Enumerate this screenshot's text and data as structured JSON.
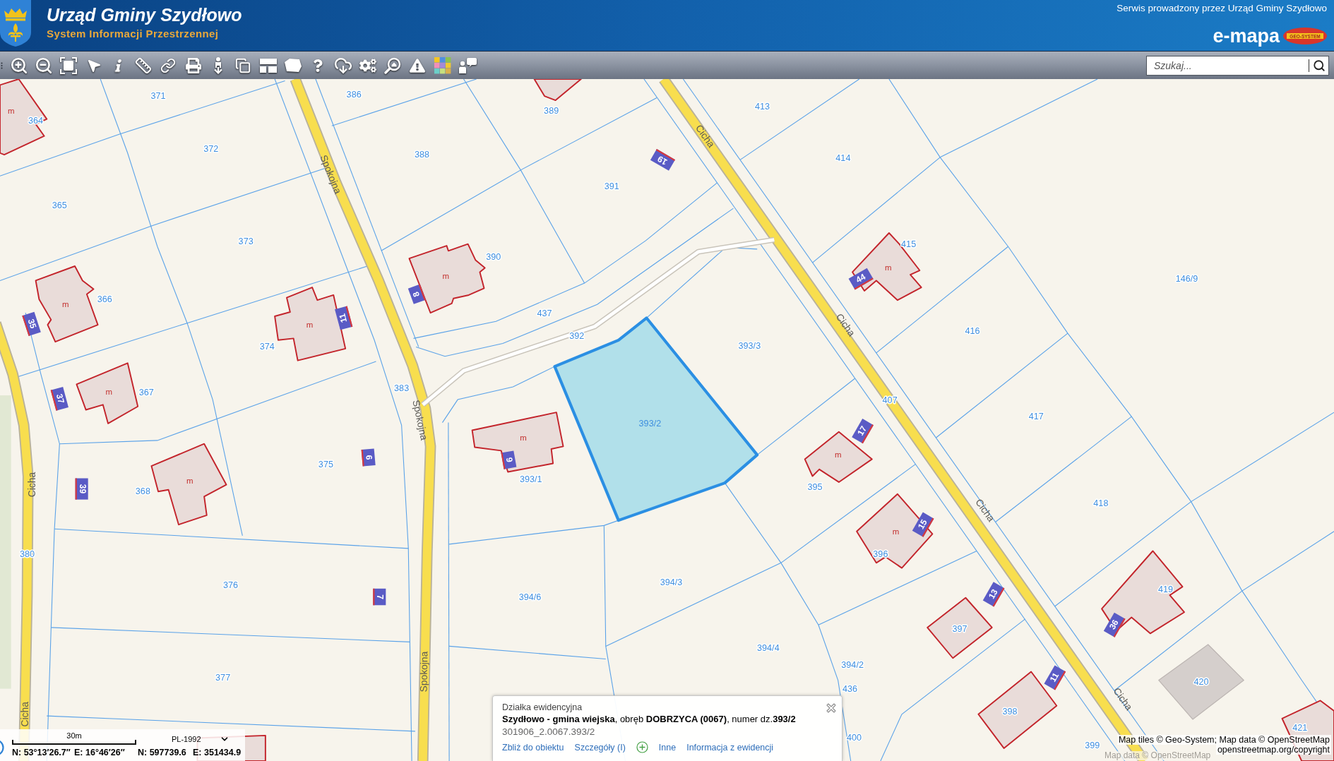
{
  "header": {
    "title": "Urząd Gminy Szydłowo",
    "subtitle": "System Informacji Przestrzennej",
    "operator": "Serwis prowadzony przez Urząd Gminy Szydłowo",
    "brand": "e-mapa",
    "brand_logo_text": "GEO-SYSTEM"
  },
  "search": {
    "placeholder": "Szukaj..."
  },
  "map": {
    "parcels": [
      "371",
      "386",
      "389",
      "413",
      "364",
      "372",
      "388",
      "414",
      "391",
      "365",
      "373",
      "415",
      "390",
      "146/9",
      "366",
      "437",
      "416",
      "392",
      "374",
      "393/3",
      "383",
      "367",
      "407",
      "417",
      "375",
      "393/1",
      "395",
      "368",
      "418",
      "380",
      "396",
      "376",
      "394/3",
      "419",
      "394/6",
      "397",
      "394/4",
      "394/2",
      "420",
      "377",
      "436",
      "398",
      "421",
      "400",
      "399"
    ],
    "selection": {
      "label": "393/2"
    },
    "streets": [
      "Spokojna",
      "Cicha",
      "Cicha",
      "Spokojna",
      "Cicha",
      "Cicha",
      "Spokojna",
      "Cicha",
      "Cicha"
    ],
    "buildings": [
      {
        "kind": "house",
        "label": "m"
      },
      {
        "kind": "house",
        "label": "m"
      },
      {
        "kind": "house",
        "label": "m"
      },
      {
        "kind": "house",
        "label": "m"
      },
      {
        "kind": "house",
        "label": "m"
      },
      {
        "kind": "house",
        "label": "m"
      },
      {
        "kind": "house",
        "label": "m"
      },
      {
        "kind": "house",
        "label": "m"
      },
      {
        "kind": "house",
        "label": "m"
      },
      {
        "kind": "house",
        "label": "m"
      },
      {
        "kind": "house"
      },
      {
        "kind": "house"
      },
      {
        "kind": "house"
      },
      {
        "kind": "outbuilding"
      },
      {
        "kind": "house"
      },
      {
        "kind": "house"
      },
      {
        "kind": "house"
      }
    ],
    "house_numbers": [
      "19",
      "8",
      "35",
      "11",
      "37",
      "6",
      "39",
      "9",
      "7",
      "44",
      "17",
      "15",
      "13",
      "36",
      "11"
    ]
  },
  "popup": {
    "heading": "Działka ewidencyjna",
    "description": "**Szydłowo - gmina wiejska**, obręb **DOBRZYCA (0067)**, numer dz.**393/2**",
    "identifier": "301906_2.0067.393/2",
    "actions": [
      {
        "kind": "link",
        "label": "Zbliż do obiektu"
      },
      {
        "kind": "link",
        "label": "Szczegóły (I)"
      },
      {
        "kind": "add"
      },
      {
        "kind": "link",
        "label": "Inne"
      },
      {
        "kind": "link",
        "label": "Informacja z ewidencji"
      }
    ]
  },
  "scale": {
    "distance": "30m",
    "projection": "PL-1992",
    "coordinates": [
      "N: 53°13′26.7″",
      "E: 16°46′26″",
      "N: 597739.6",
      "E: 351434.9"
    ]
  },
  "attribution": {
    "lines": [
      "Map tiles © Geo-System; Map data © OpenStreetMap",
      "openstreetmap.org/copyright"
    ],
    "tile_text": "Map data © OpenStreetMap"
  }
}
